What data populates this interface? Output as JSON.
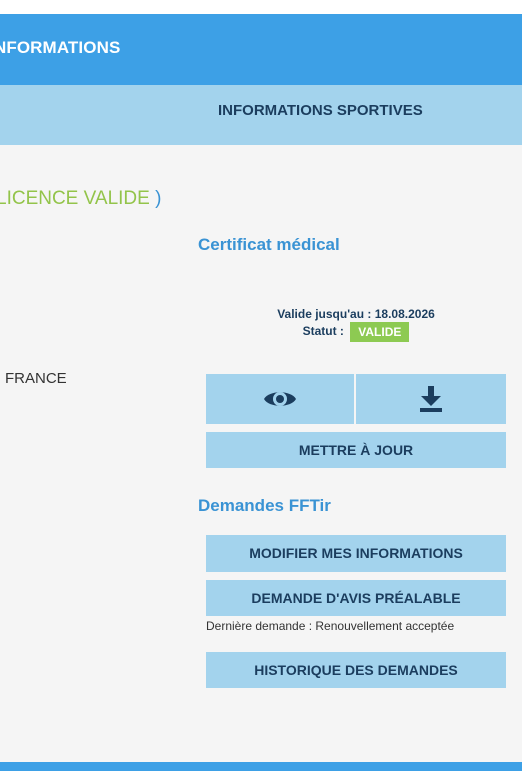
{
  "header": {
    "title": "NFORMATIONS"
  },
  "tabs": {
    "active_label": "INFORMATIONS SPORTIVES"
  },
  "licence": {
    "text": "LICENCE VALIDE",
    "close_paren": ")"
  },
  "certificat": {
    "title": "Certificat médical",
    "valid_until": "Valide jusqu'au : 18.08.2026",
    "status_label": "Statut :",
    "status_value": "VALIDE",
    "view_icon": "eye-icon",
    "download_icon": "download-icon",
    "update_label": "METTRE À JOUR"
  },
  "country": {
    "value": "FRANCE"
  },
  "demandes": {
    "title": "Demandes FFTir",
    "modify_label": "MODIFIER MES INFORMATIONS",
    "avis_label": "DEMANDE D'AVIS PRÉALABLE",
    "last_request": "Dernière demande : Renouvellement acceptée",
    "history_label": "HISTORIQUE DES DEMANDES"
  },
  "colors": {
    "header_blue": "#3da0e6",
    "light_blue": "#a3d3ed",
    "navy_text": "#1b3d5e",
    "accent_blue": "#3a93d4",
    "valid_green": "#8dca52",
    "licence_green": "#93c44a"
  }
}
